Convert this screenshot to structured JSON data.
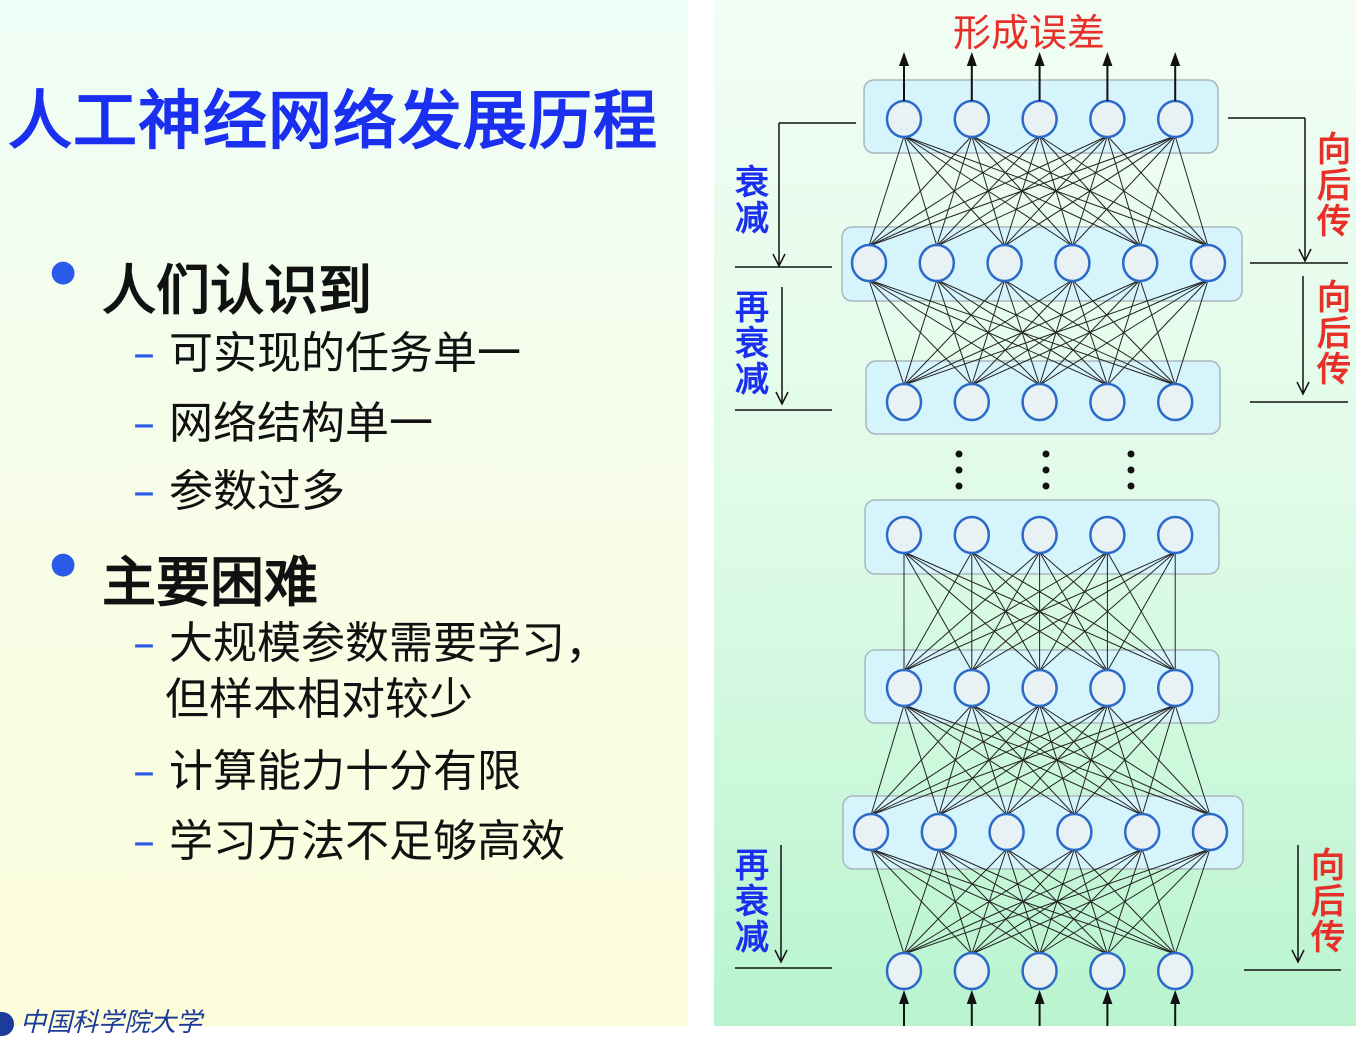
{
  "title": "人工神经网络发展历程",
  "bullets": [
    {
      "label": "人们认识到",
      "items": [
        "可实现的任务单一",
        "网络结构单一",
        "参数过多"
      ]
    },
    {
      "label": "主要困难",
      "items": [
        "大规模参数需要学习，但样本相对较少",
        "计算能力十分有限",
        "学习方法不足够高效"
      ]
    }
  ],
  "item_lines": {
    "a": "大规模参数需要学习，",
    "b": "但样本相对较少"
  },
  "logo_text": "中国科学院大学",
  "diagram": {
    "top_label": "形成误差",
    "decay_label": "衰减",
    "redecay_label": "再衰减",
    "backprop_label": "向后传",
    "layers_node_counts": [
      5,
      6,
      5,
      5,
      5,
      6,
      5
    ],
    "colors": {
      "title": "#1a2ff0",
      "bullet": "#2a5be8",
      "decay": "#1a2ff0",
      "backprop": "#e8302a",
      "node_stroke": "#2a6ac8",
      "node_fill": "#e8f2f4",
      "layer_box": "#d6f4fc"
    }
  }
}
